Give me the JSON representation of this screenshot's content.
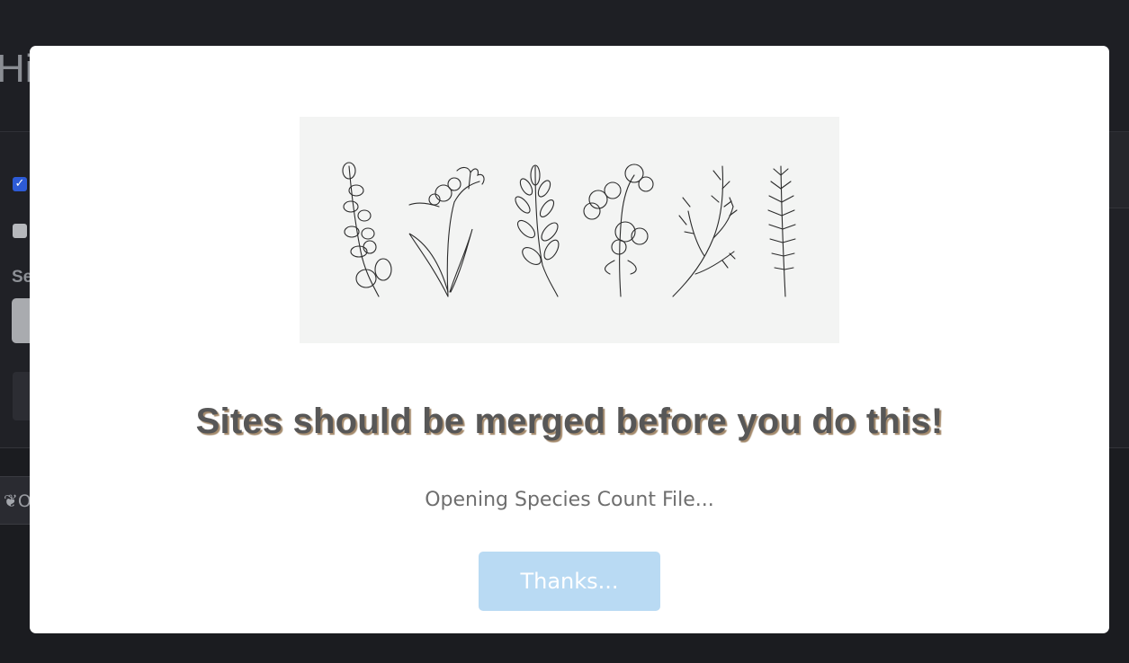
{
  "background": {
    "title": "His",
    "label_partial": "Se",
    "tab_partial": "O",
    "checkbox_checked_mark": "✓"
  },
  "modal": {
    "illustration": "botanical-line-drawings",
    "heading": "Sites should be merged before you do this!",
    "message": "Opening Species Count File...",
    "button_label": "Thanks..."
  },
  "colors": {
    "overlay": "#1b1c20",
    "modal_bg": "#ffffff",
    "button_bg": "#b9daf3",
    "heading": "#575757",
    "heading_shadow": "#a48a6c"
  }
}
